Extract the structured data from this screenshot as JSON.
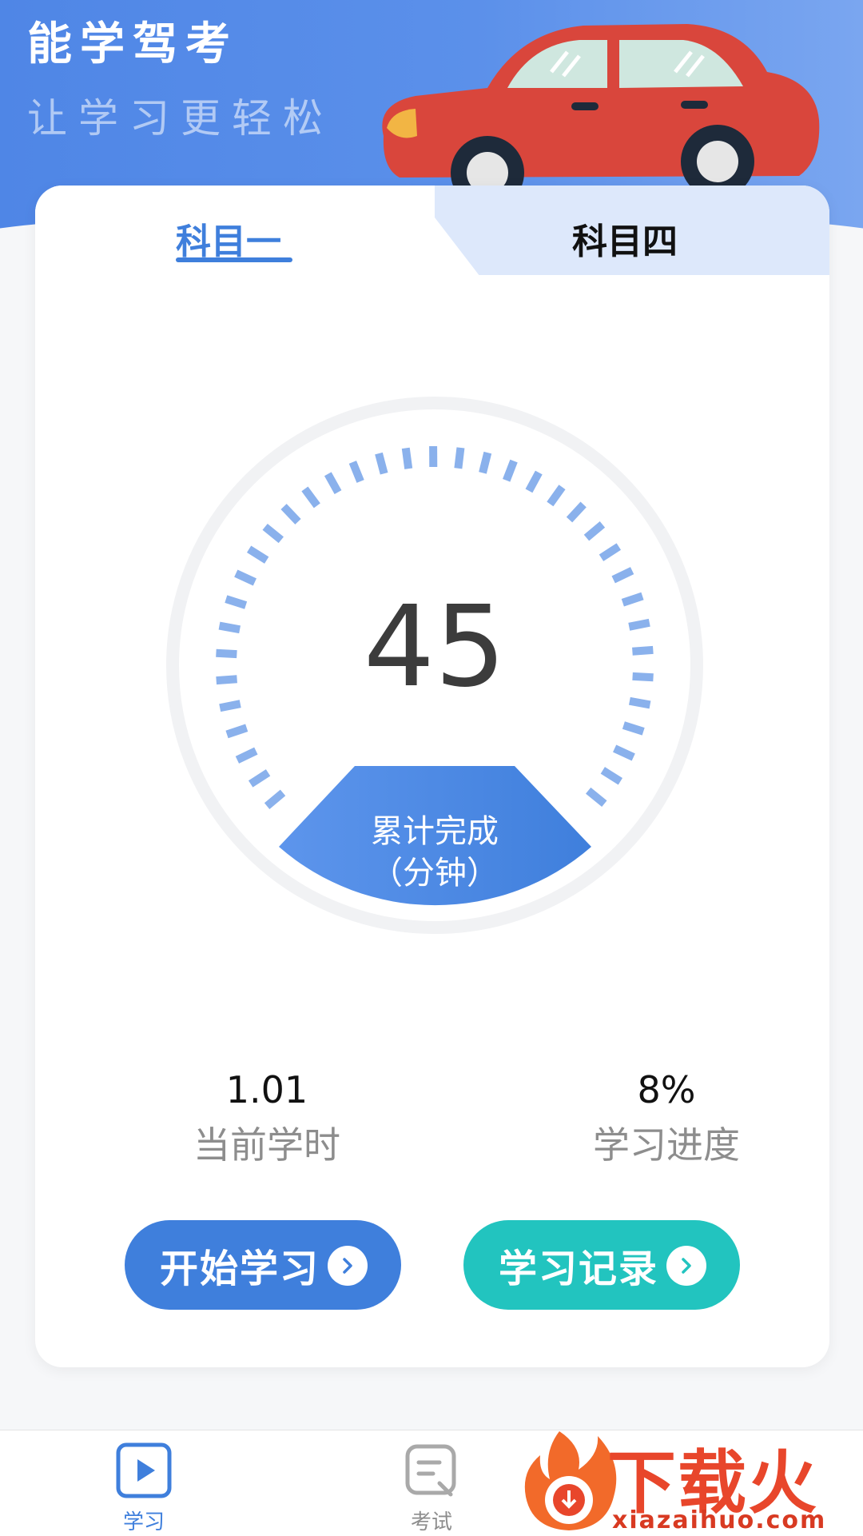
{
  "header": {
    "title": "能学驾考",
    "subtitle": "让学习更轻松"
  },
  "tabs": [
    {
      "label": "科目一",
      "active": true
    },
    {
      "label": "科目四",
      "active": false
    }
  ],
  "gauge": {
    "value": "45",
    "label_line1": "累计完成",
    "label_line2": "（分钟）"
  },
  "stats": {
    "hours": {
      "value": "1.01",
      "label": "当前学时"
    },
    "progress": {
      "value": "8%",
      "label": "学习进度"
    }
  },
  "buttons": {
    "start": "开始学习",
    "record": "学习记录"
  },
  "bottom_nav": [
    {
      "label": "学习",
      "icon": "play-icon",
      "active": true
    },
    {
      "label": "考试",
      "icon": "exam-icon",
      "active": false
    }
  ],
  "watermark": {
    "text": "下载火",
    "url": "xiazaihuo.com"
  },
  "colors": {
    "primary": "#3f7fdc",
    "teal": "#22c4bf",
    "header": "#5b90ea"
  }
}
